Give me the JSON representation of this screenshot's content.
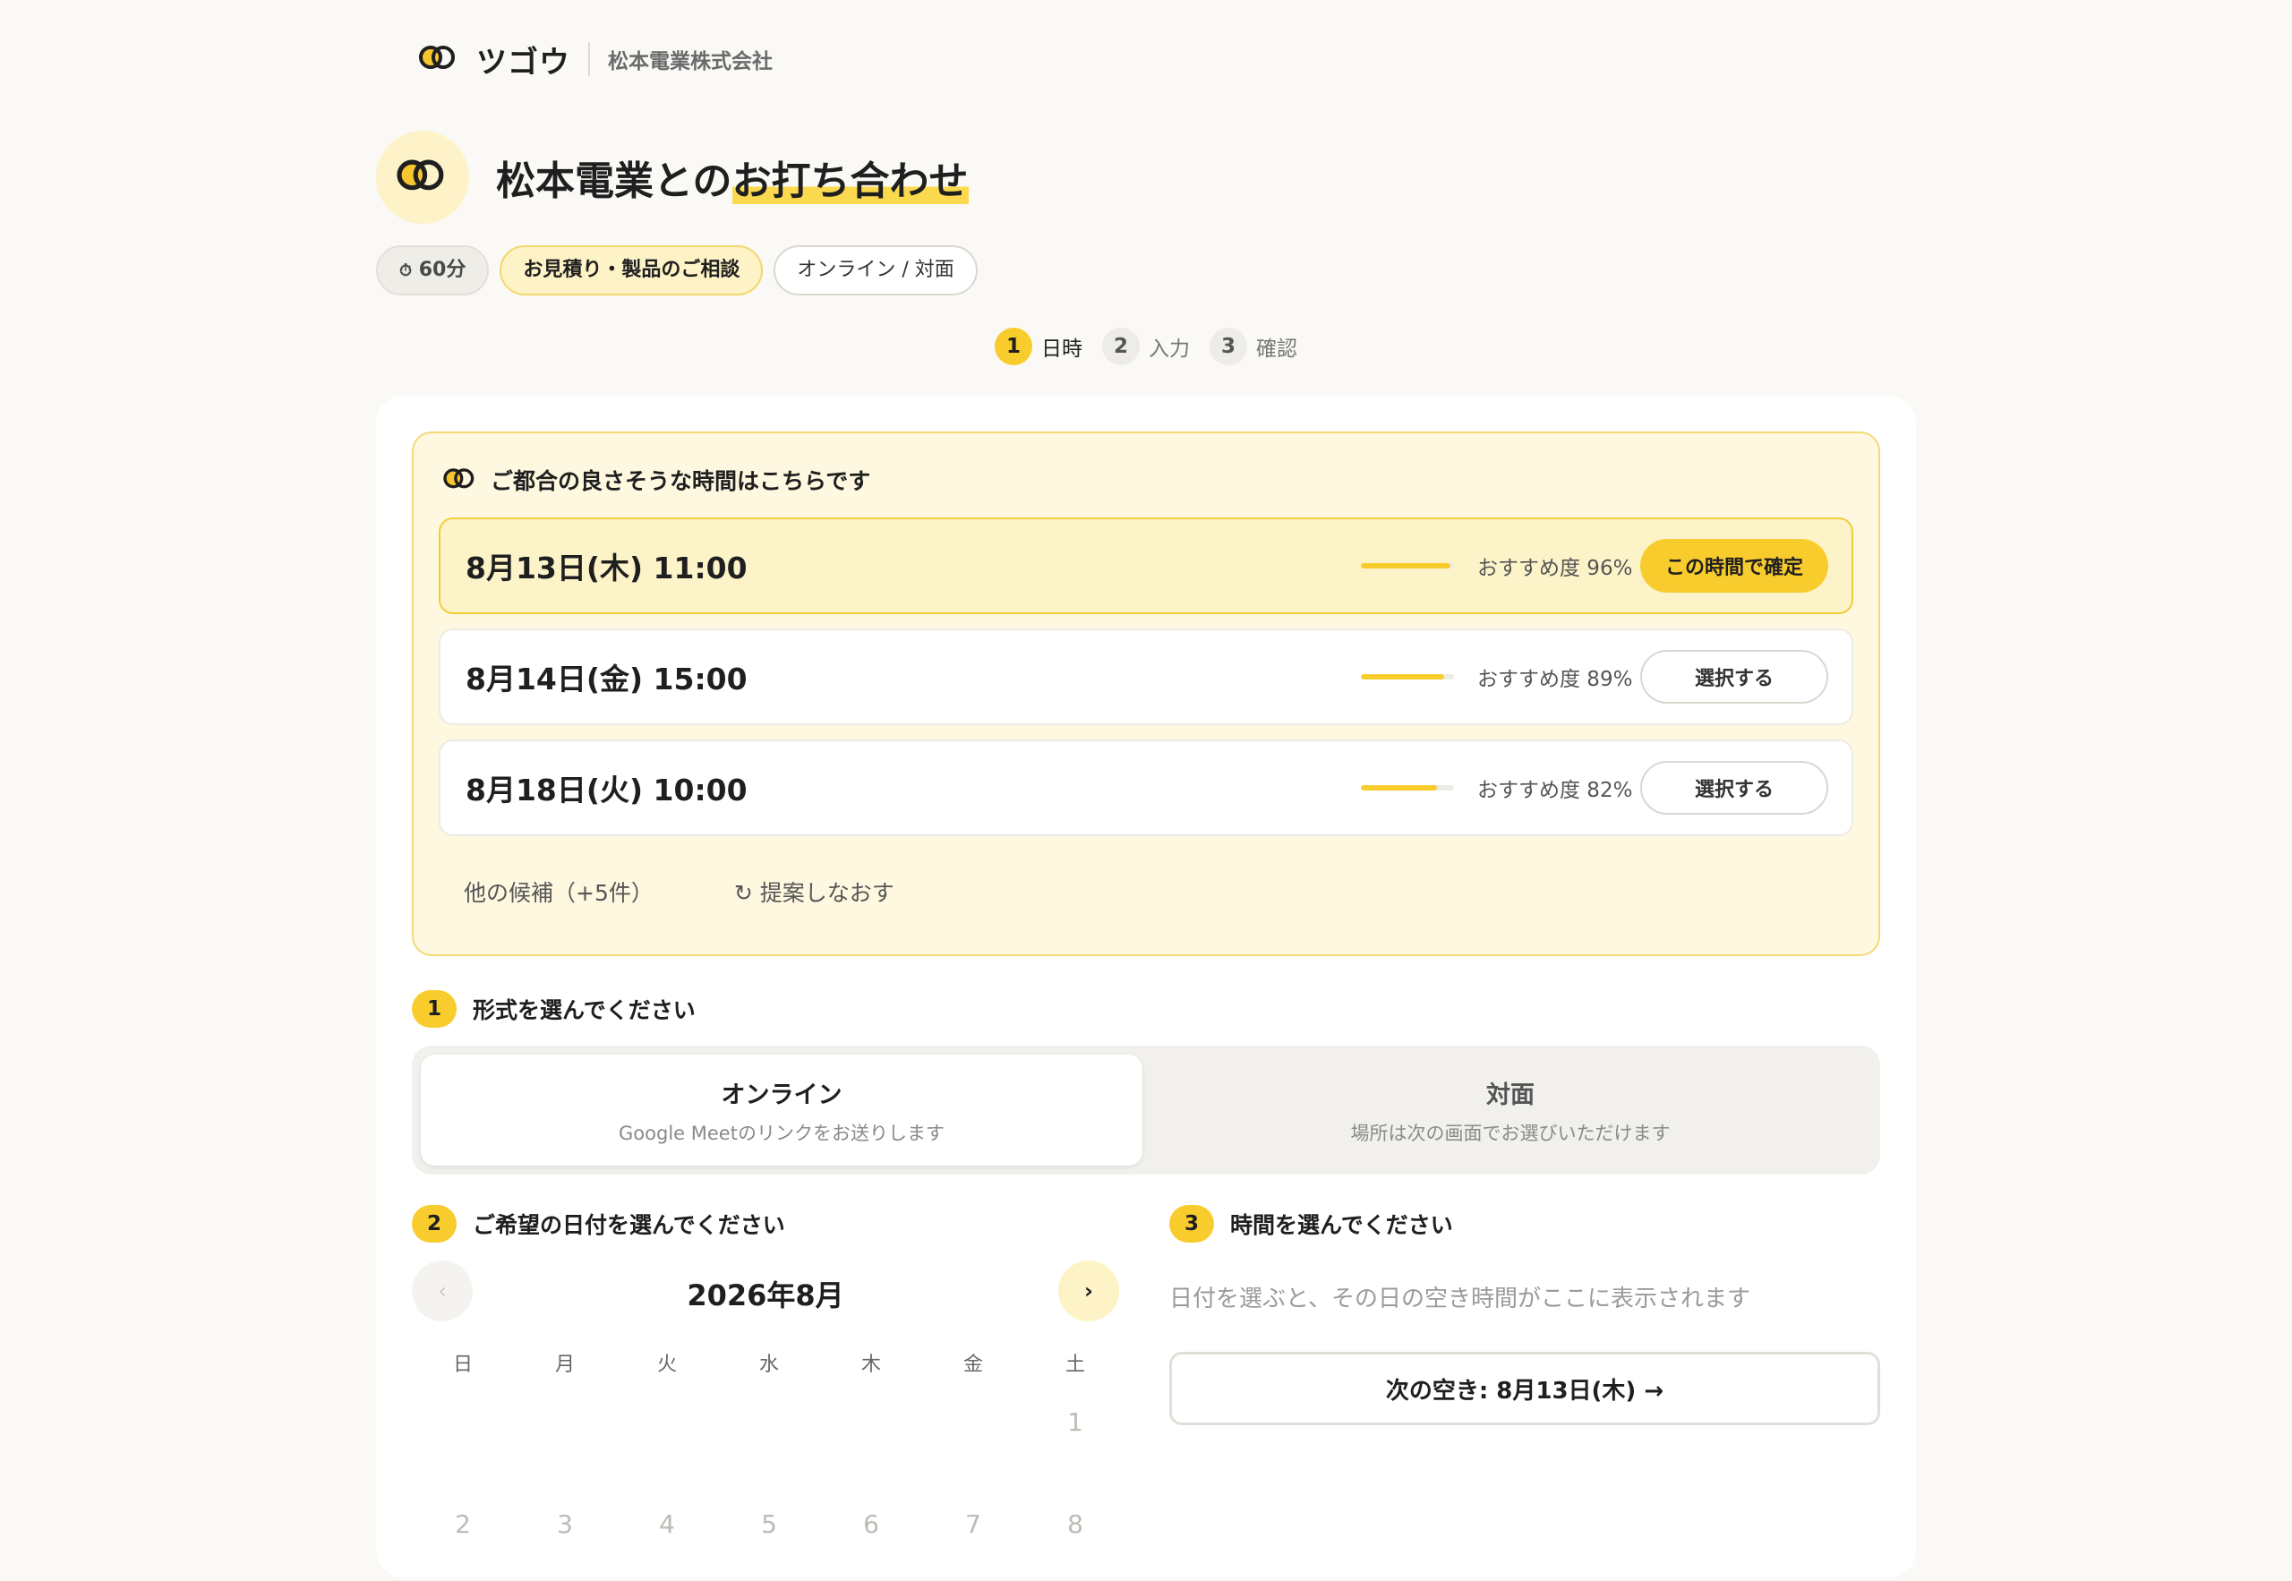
{
  "header": {
    "brand": "ツゴウ",
    "company": "松本電業株式会社"
  },
  "title": {
    "prefix": "松本電業との",
    "highlight": "お打ち合わせ"
  },
  "tags": {
    "duration_icon": "⏱",
    "duration": "60分",
    "purpose": "お見積り・製品のご相談",
    "mode": "オンライン / 対面"
  },
  "steps": [
    {
      "num": "1",
      "label": "日時"
    },
    {
      "num": "2",
      "label": "入力"
    },
    {
      "num": "3",
      "label": "確認"
    }
  ],
  "suggest": {
    "heading": "ご都合の良さそうな時間はこちらです",
    "slots": [
      {
        "datetime": "8月13日(木) 11:00",
        "score_text": "おすすめ度 96%",
        "score": 96,
        "action": "この時間で確定"
      },
      {
        "datetime": "8月14日(金) 15:00",
        "score_text": "おすすめ度 89%",
        "score": 89,
        "action": "選択する"
      },
      {
        "datetime": "8月18日(火) 10:00",
        "score_text": "おすすめ度 82%",
        "score": 82,
        "action": "選択する"
      }
    ],
    "more": "他の候補（+5件）",
    "retry": "↻ 提案しなおす"
  },
  "format_section": {
    "num": "1",
    "heading": "形式を選んでください",
    "online_title": "オンライン",
    "online_sub": "Google Meetのリンクをお送りします",
    "offline_title": "対面",
    "offline_sub": "場所は次の画面でお選びいただけます"
  },
  "date_section": {
    "num": "2",
    "heading": "ご希望の日付を選んでください",
    "prev": "‹",
    "next": "›",
    "month": "2026年8月",
    "weekdays": [
      "日",
      "月",
      "火",
      "水",
      "木",
      "金",
      "土"
    ],
    "week1": [
      "",
      "",
      "",
      "",
      "",
      "",
      "1"
    ],
    "week2": [
      "2",
      "3",
      "4",
      "5",
      "6",
      "7",
      "8"
    ]
  },
  "time_section": {
    "num": "3",
    "heading": "時間を選んでください",
    "hint": "日付を選ぶと、その日の空き時間がここに表示されます",
    "next_available": "次の空き: 8月13日(木) →"
  },
  "colors": {
    "accent": "#f9cc2d",
    "accent_light": "#fdf3c6",
    "background": "#faf9f6"
  }
}
